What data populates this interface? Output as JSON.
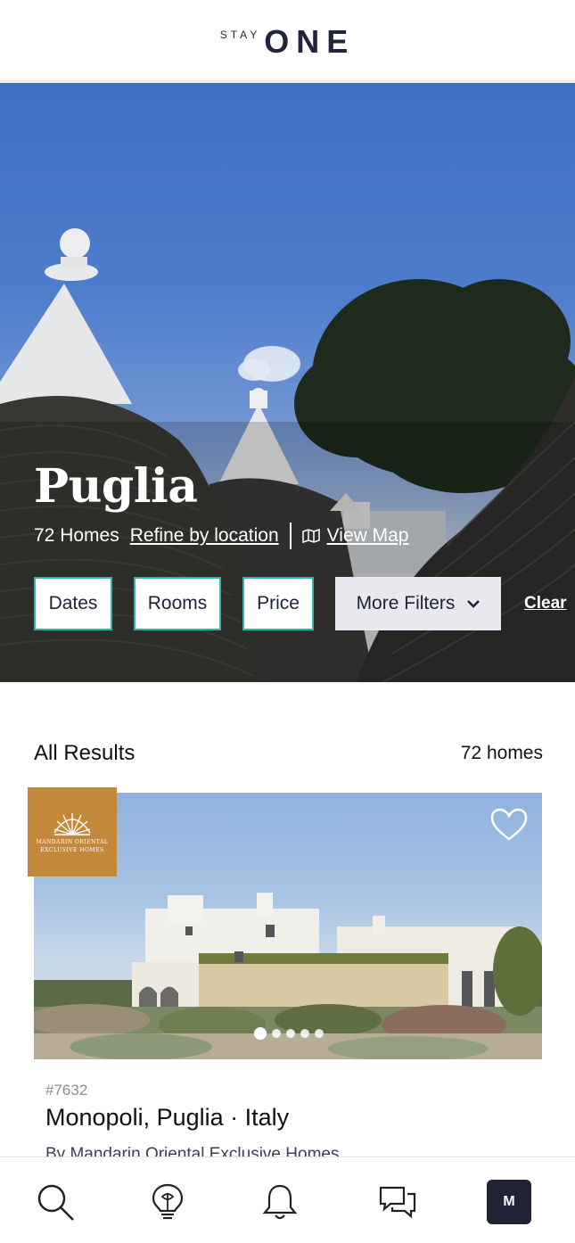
{
  "header": {
    "logo_small": "STAY",
    "logo_large": "ONE"
  },
  "hero": {
    "title": "Puglia",
    "homes_count": "72 Homes",
    "refine_label": "Refine by location",
    "view_map_label": "View Map"
  },
  "filters": {
    "dates": "Dates",
    "rooms": "Rooms",
    "price": "Price",
    "more": "More Filters",
    "clear": "Clear"
  },
  "results": {
    "title": "All Results",
    "count": "72 homes"
  },
  "listing": {
    "badge_line1": "MANDARIN ORIENTAL",
    "badge_line2": "EXCLUSIVE HOMES",
    "id": "#7632",
    "title": "Monopoli, Puglia · Italy",
    "by": "By Mandarin Oriental Exclusive Homes",
    "photo_count": 5,
    "active_photo": 1
  },
  "nav": {
    "items": [
      "search-icon",
      "ideas-icon",
      "notifications-icon",
      "messages-icon"
    ],
    "avatar_initial": "M"
  },
  "colors": {
    "accent": "#2fb7a8",
    "brand_dark": "#22243d",
    "badge": "#c4883a"
  }
}
